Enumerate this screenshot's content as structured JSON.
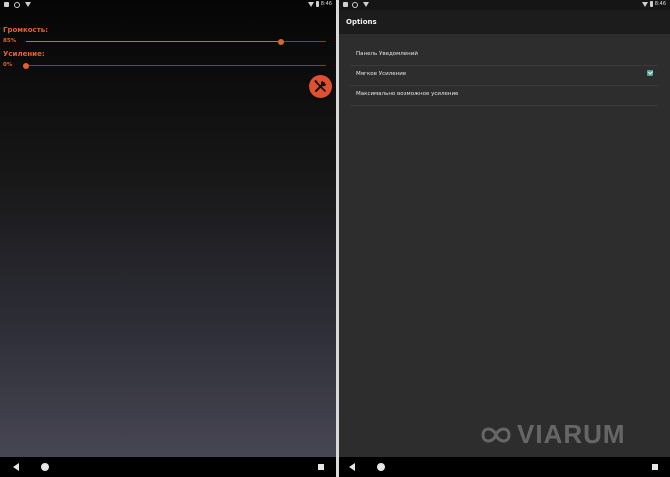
{
  "left_screen": {
    "status_time": "8:46",
    "volume_label": "Громкость:",
    "volume_percent": "85%",
    "volume_value": 0.85,
    "boost_label": "Усиление:",
    "boost_percent": "0%",
    "boost_value": 0.0,
    "fab_icon": "wrench-screwdriver-icon"
  },
  "right_screen": {
    "status_time": "8:46",
    "appbar_title": "Options",
    "options": [
      {
        "label": "Панель Уведомлений",
        "checked": null
      },
      {
        "label": "Мягкое Усиление",
        "checked": true
      },
      {
        "label": "Максимально возможное усиление",
        "checked": null
      }
    ]
  },
  "watermark": {
    "text": "VIARUM"
  },
  "colors": {
    "accent": "#e0632f",
    "checkbox": "#4ca69a",
    "fab": "#e05030"
  }
}
